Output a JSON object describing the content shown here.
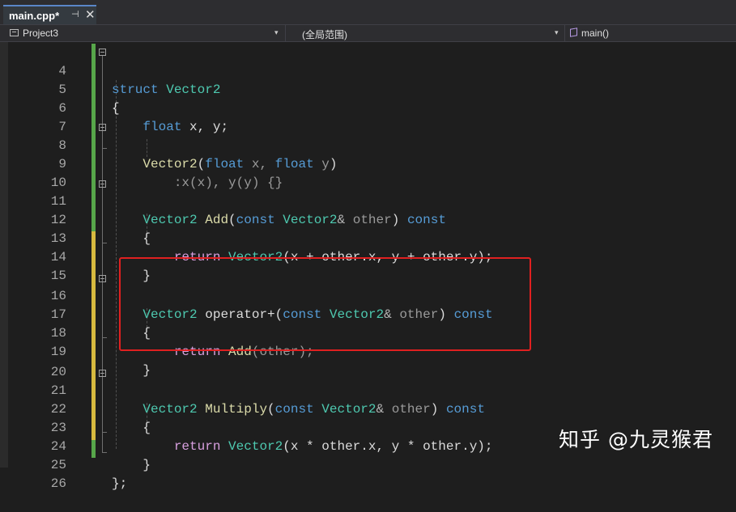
{
  "tab": {
    "title": "main.cpp*",
    "pin_glyph": "⊣",
    "close_glyph": "✕"
  },
  "navbar": {
    "project": "Project3",
    "scope": "(全局范围)",
    "member": "main()",
    "dropdown_glyph": "▾"
  },
  "lines": [
    {
      "n": "4"
    },
    {
      "n": "5"
    },
    {
      "n": "6"
    },
    {
      "n": "7"
    },
    {
      "n": "8"
    },
    {
      "n": "9"
    },
    {
      "n": "10"
    },
    {
      "n": "11"
    },
    {
      "n": "12"
    },
    {
      "n": "13"
    },
    {
      "n": "14"
    },
    {
      "n": "15"
    },
    {
      "n": "16"
    },
    {
      "n": "17"
    },
    {
      "n": "18"
    },
    {
      "n": "19"
    },
    {
      "n": "20"
    },
    {
      "n": "21"
    },
    {
      "n": "22"
    },
    {
      "n": "23"
    },
    {
      "n": "24"
    },
    {
      "n": "25"
    },
    {
      "n": "26"
    }
  ],
  "code": {
    "l4": {
      "kw": "struct",
      "type": "Vector2"
    },
    "l5": {
      "brace": "{"
    },
    "l6": {
      "kw": "float",
      "vars": "x, y;"
    },
    "l8": {
      "type": "Vector2",
      "p1": "(",
      "kw1": "float",
      "a1": "x,",
      "kw2": "float",
      "a2": "y",
      "p2": ")"
    },
    "l9": {
      "init": ":x(x), y(y) {}"
    },
    "l11": {
      "type": "Vector2",
      "fn": "Add",
      "p1": "(",
      "kw": "const",
      "ptype": "Vector2",
      "amp": "&",
      "param": "other",
      "p2": ")",
      "kw2": "const"
    },
    "l12": {
      "brace": "{"
    },
    "l13": {
      "ret": "return",
      "type": "Vector2",
      "expr": "(x + other.x, y + other.y);"
    },
    "l14": {
      "brace": "}"
    },
    "l16": {
      "type": "Vector2",
      "op": "operator+",
      "p1": "(",
      "kw": "const",
      "ptype": "Vector2",
      "amp": "&",
      "param": "other",
      "p2": ")",
      "kw2": "const"
    },
    "l17": {
      "brace": "{"
    },
    "l18": {
      "ret": "return",
      "fn": "Add",
      "expr": "(other);"
    },
    "l19": {
      "brace": "}"
    },
    "l21": {
      "type": "Vector2",
      "fn": "Multiply",
      "p1": "(",
      "kw": "const",
      "ptype": "Vector2",
      "amp": "&",
      "param": "other",
      "p2": ")",
      "kw2": "const"
    },
    "l22": {
      "brace": "{"
    },
    "l23": {
      "ret": "return",
      "type": "Vector2",
      "expr": "(x * other.x, y * other.y);"
    },
    "l24": {
      "brace": "}"
    },
    "l25": {
      "brace": "};"
    }
  },
  "watermark": "知乎 @九灵猴君",
  "colors": {
    "keyword": "#569cd6",
    "type": "#4ec9b0",
    "function": "#dcdcaa",
    "control": "#d8a0df",
    "highlight_box": "#e02020",
    "change_saved": "#57a64a",
    "change_unsaved": "#d7ba3f"
  }
}
